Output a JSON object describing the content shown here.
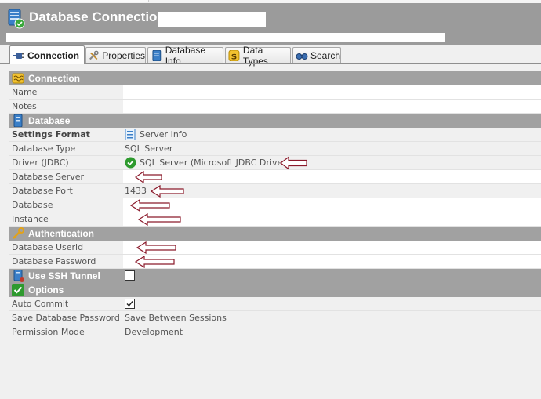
{
  "header": {
    "title": "Database Connection:",
    "title_value": "",
    "subtitle": ""
  },
  "tabs": [
    {
      "label": "Connection",
      "icon": "plug-icon",
      "active": true
    },
    {
      "label": "Properties",
      "icon": "tools-icon",
      "active": false
    },
    {
      "label": "Database Info",
      "icon": "database-icon",
      "active": false
    },
    {
      "label": "Data Types",
      "icon": "dollar-icon",
      "active": false
    },
    {
      "label": "Search",
      "icon": "binoculars-icon",
      "active": false
    }
  ],
  "sections": {
    "connection": {
      "label": "Connection",
      "fields": {
        "name": {
          "label": "Name",
          "value": ""
        },
        "notes": {
          "label": "Notes",
          "value": ""
        }
      }
    },
    "database": {
      "label": "Database",
      "fields": {
        "settings_format": {
          "label": "Settings Format",
          "value": "Server Info"
        },
        "database_type": {
          "label": "Database Type",
          "value": "SQL Server"
        },
        "driver": {
          "label": "Driver (JDBC)",
          "value": "SQL Server (Microsoft JDBC Driver)"
        },
        "database_server": {
          "label": "Database Server",
          "value": ""
        },
        "database_port": {
          "label": "Database Port",
          "value": "1433"
        },
        "database": {
          "label": "Database",
          "value": ""
        },
        "instance": {
          "label": "Instance",
          "value": ""
        }
      }
    },
    "authentication": {
      "label": "Authentication",
      "fields": {
        "userid": {
          "label": "Database Userid",
          "value": ""
        },
        "password": {
          "label": "Database Password",
          "value": ""
        }
      }
    },
    "ssh": {
      "label": "Use SSH Tunnel",
      "checked": false
    },
    "options": {
      "label": "Options",
      "fields": {
        "auto_commit": {
          "label": "Auto Commit",
          "checked": true
        },
        "save_password": {
          "label": "Save Database Password",
          "value": "Save Between Sessions"
        },
        "permission_mode": {
          "label": "Permission Mode",
          "value": "Development"
        }
      }
    }
  },
  "colors": {
    "section_bg": "#a1a1a1",
    "header_bg": "#9b9b9b",
    "annotation_arrow": "#8b1a2b",
    "check_green": "#2e9a2e"
  }
}
